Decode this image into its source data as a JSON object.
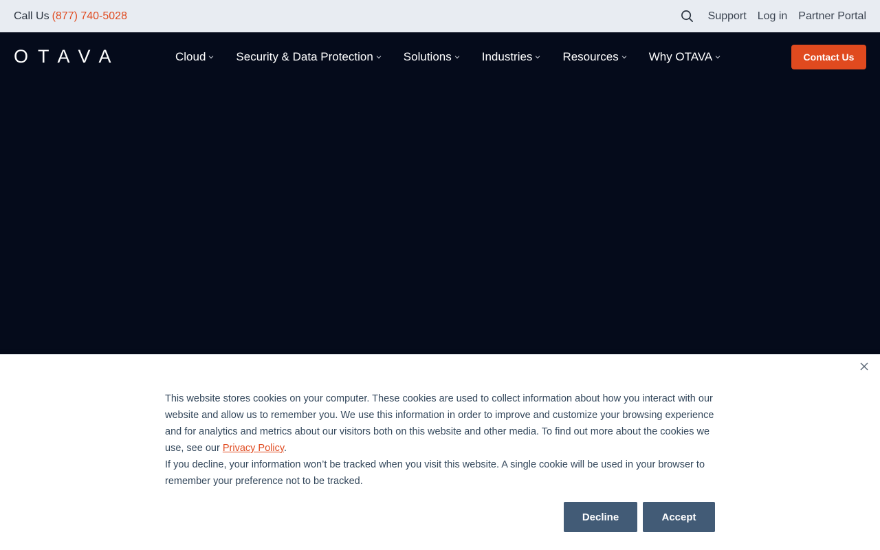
{
  "topbar": {
    "call_label": "Call Us",
    "phone": "(877) 740-5028",
    "links": [
      "Support",
      "Log in",
      "Partner Portal"
    ]
  },
  "navbar": {
    "logo": "OTAVA",
    "items": [
      "Cloud",
      "Security & Data Protection",
      "Solutions",
      "Industries",
      "Resources",
      "Why OTAVA"
    ],
    "contact_label": "Contact Us"
  },
  "cookie": {
    "paragraph1_pre": "This website stores cookies on your computer. These cookies are used to collect information about how you interact with our website and allow us to remember you. We use this information in order to improve and customize your browsing experience and for analytics and metrics about our visitors both on this website and other media. To find out more about the cookies we use, see our",
    "privacy_link": "Privacy Policy",
    "paragraph1_post": ".",
    "paragraph2": "If you decline, your information won’t be tracked when you visit this website. A single cookie will be used in your browser to remember your preference not to be tracked.",
    "decline_label": "Decline",
    "accept_label": "Accept"
  },
  "colors": {
    "accent": "#e04a1f",
    "navy": "#050b1b",
    "button": "#425b76"
  }
}
